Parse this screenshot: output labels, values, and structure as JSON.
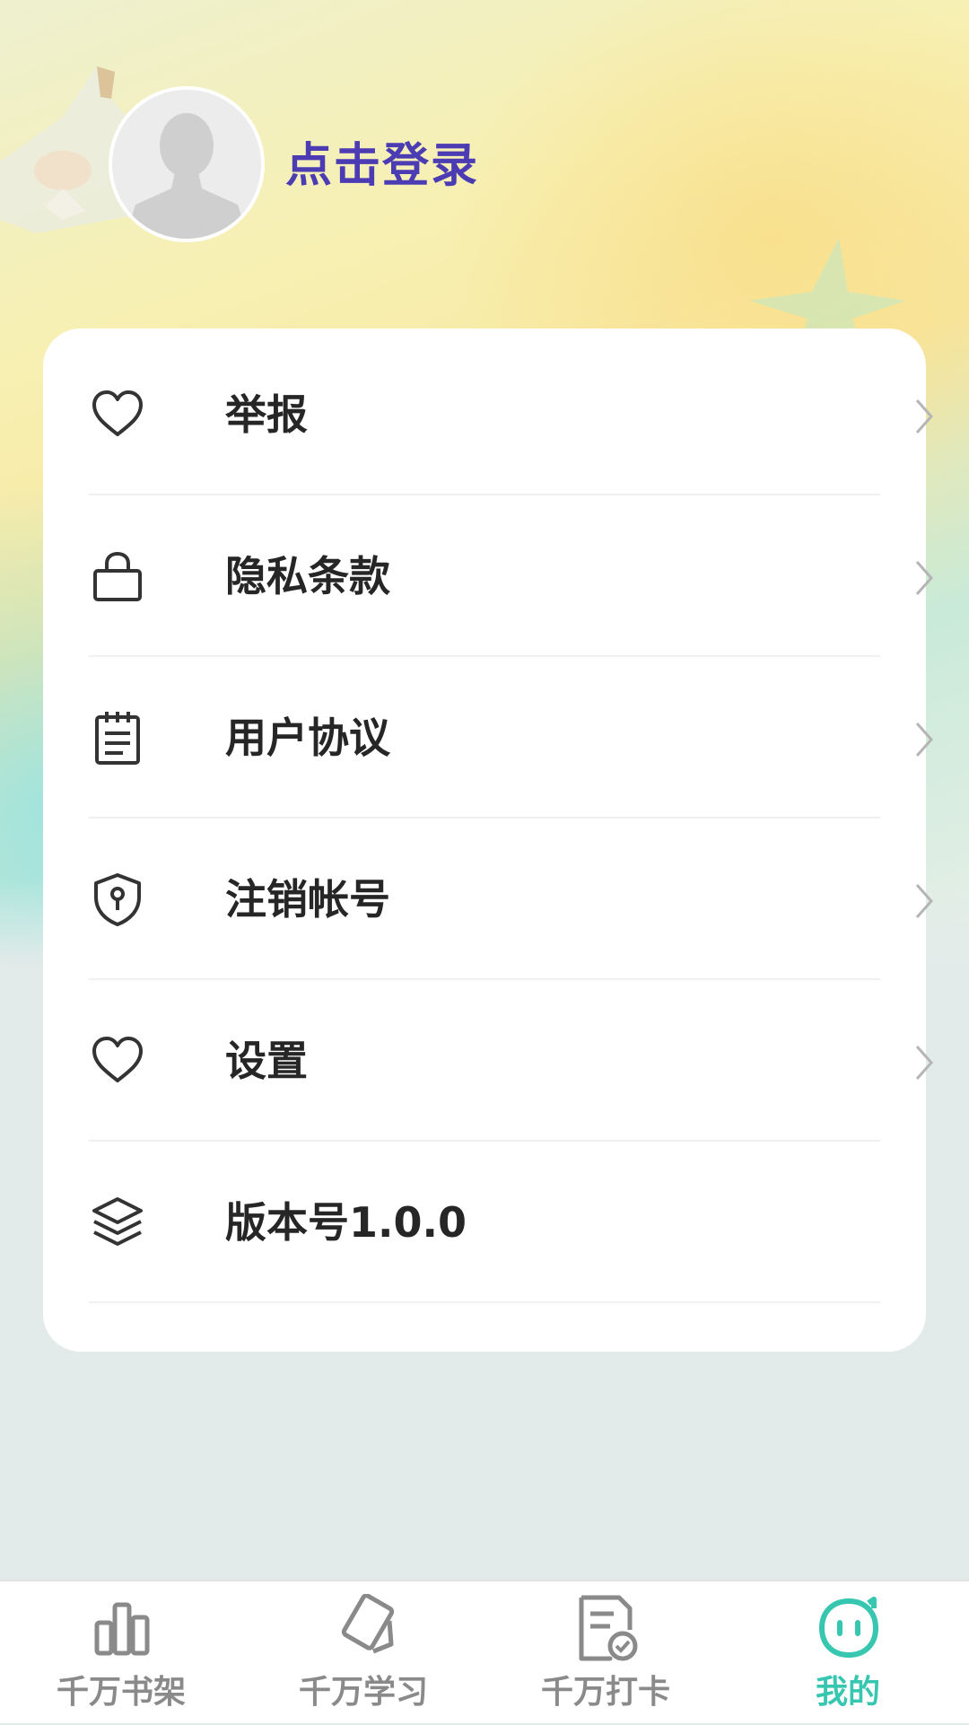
{
  "profile": {
    "login_label": "点击登录"
  },
  "menu": [
    {
      "label": "举报",
      "icon": "heart-icon"
    },
    {
      "label": "隐私条款",
      "icon": "lock-icon"
    },
    {
      "label": "用户协议",
      "icon": "notepad-icon"
    },
    {
      "label": "注销帐号",
      "icon": "shield-icon"
    },
    {
      "label": "设置",
      "icon": "heart-icon"
    },
    {
      "label": "版本号1.0.0",
      "icon": "layers-icon"
    }
  ],
  "tabs": [
    {
      "label": "千万书架",
      "icon": "bar-chart-icon",
      "active": false
    },
    {
      "label": "千万学习",
      "icon": "cards-icon",
      "active": false
    },
    {
      "label": "千万打卡",
      "icon": "check-document-icon",
      "active": false
    },
    {
      "label": "我的",
      "icon": "smiley-face-icon",
      "active": true
    }
  ],
  "colors": {
    "login_text": "#4c3cb4",
    "active_tab": "#37c6b0",
    "inactive_tab": "#8a8a8a",
    "page_background": "#e3ebea"
  }
}
